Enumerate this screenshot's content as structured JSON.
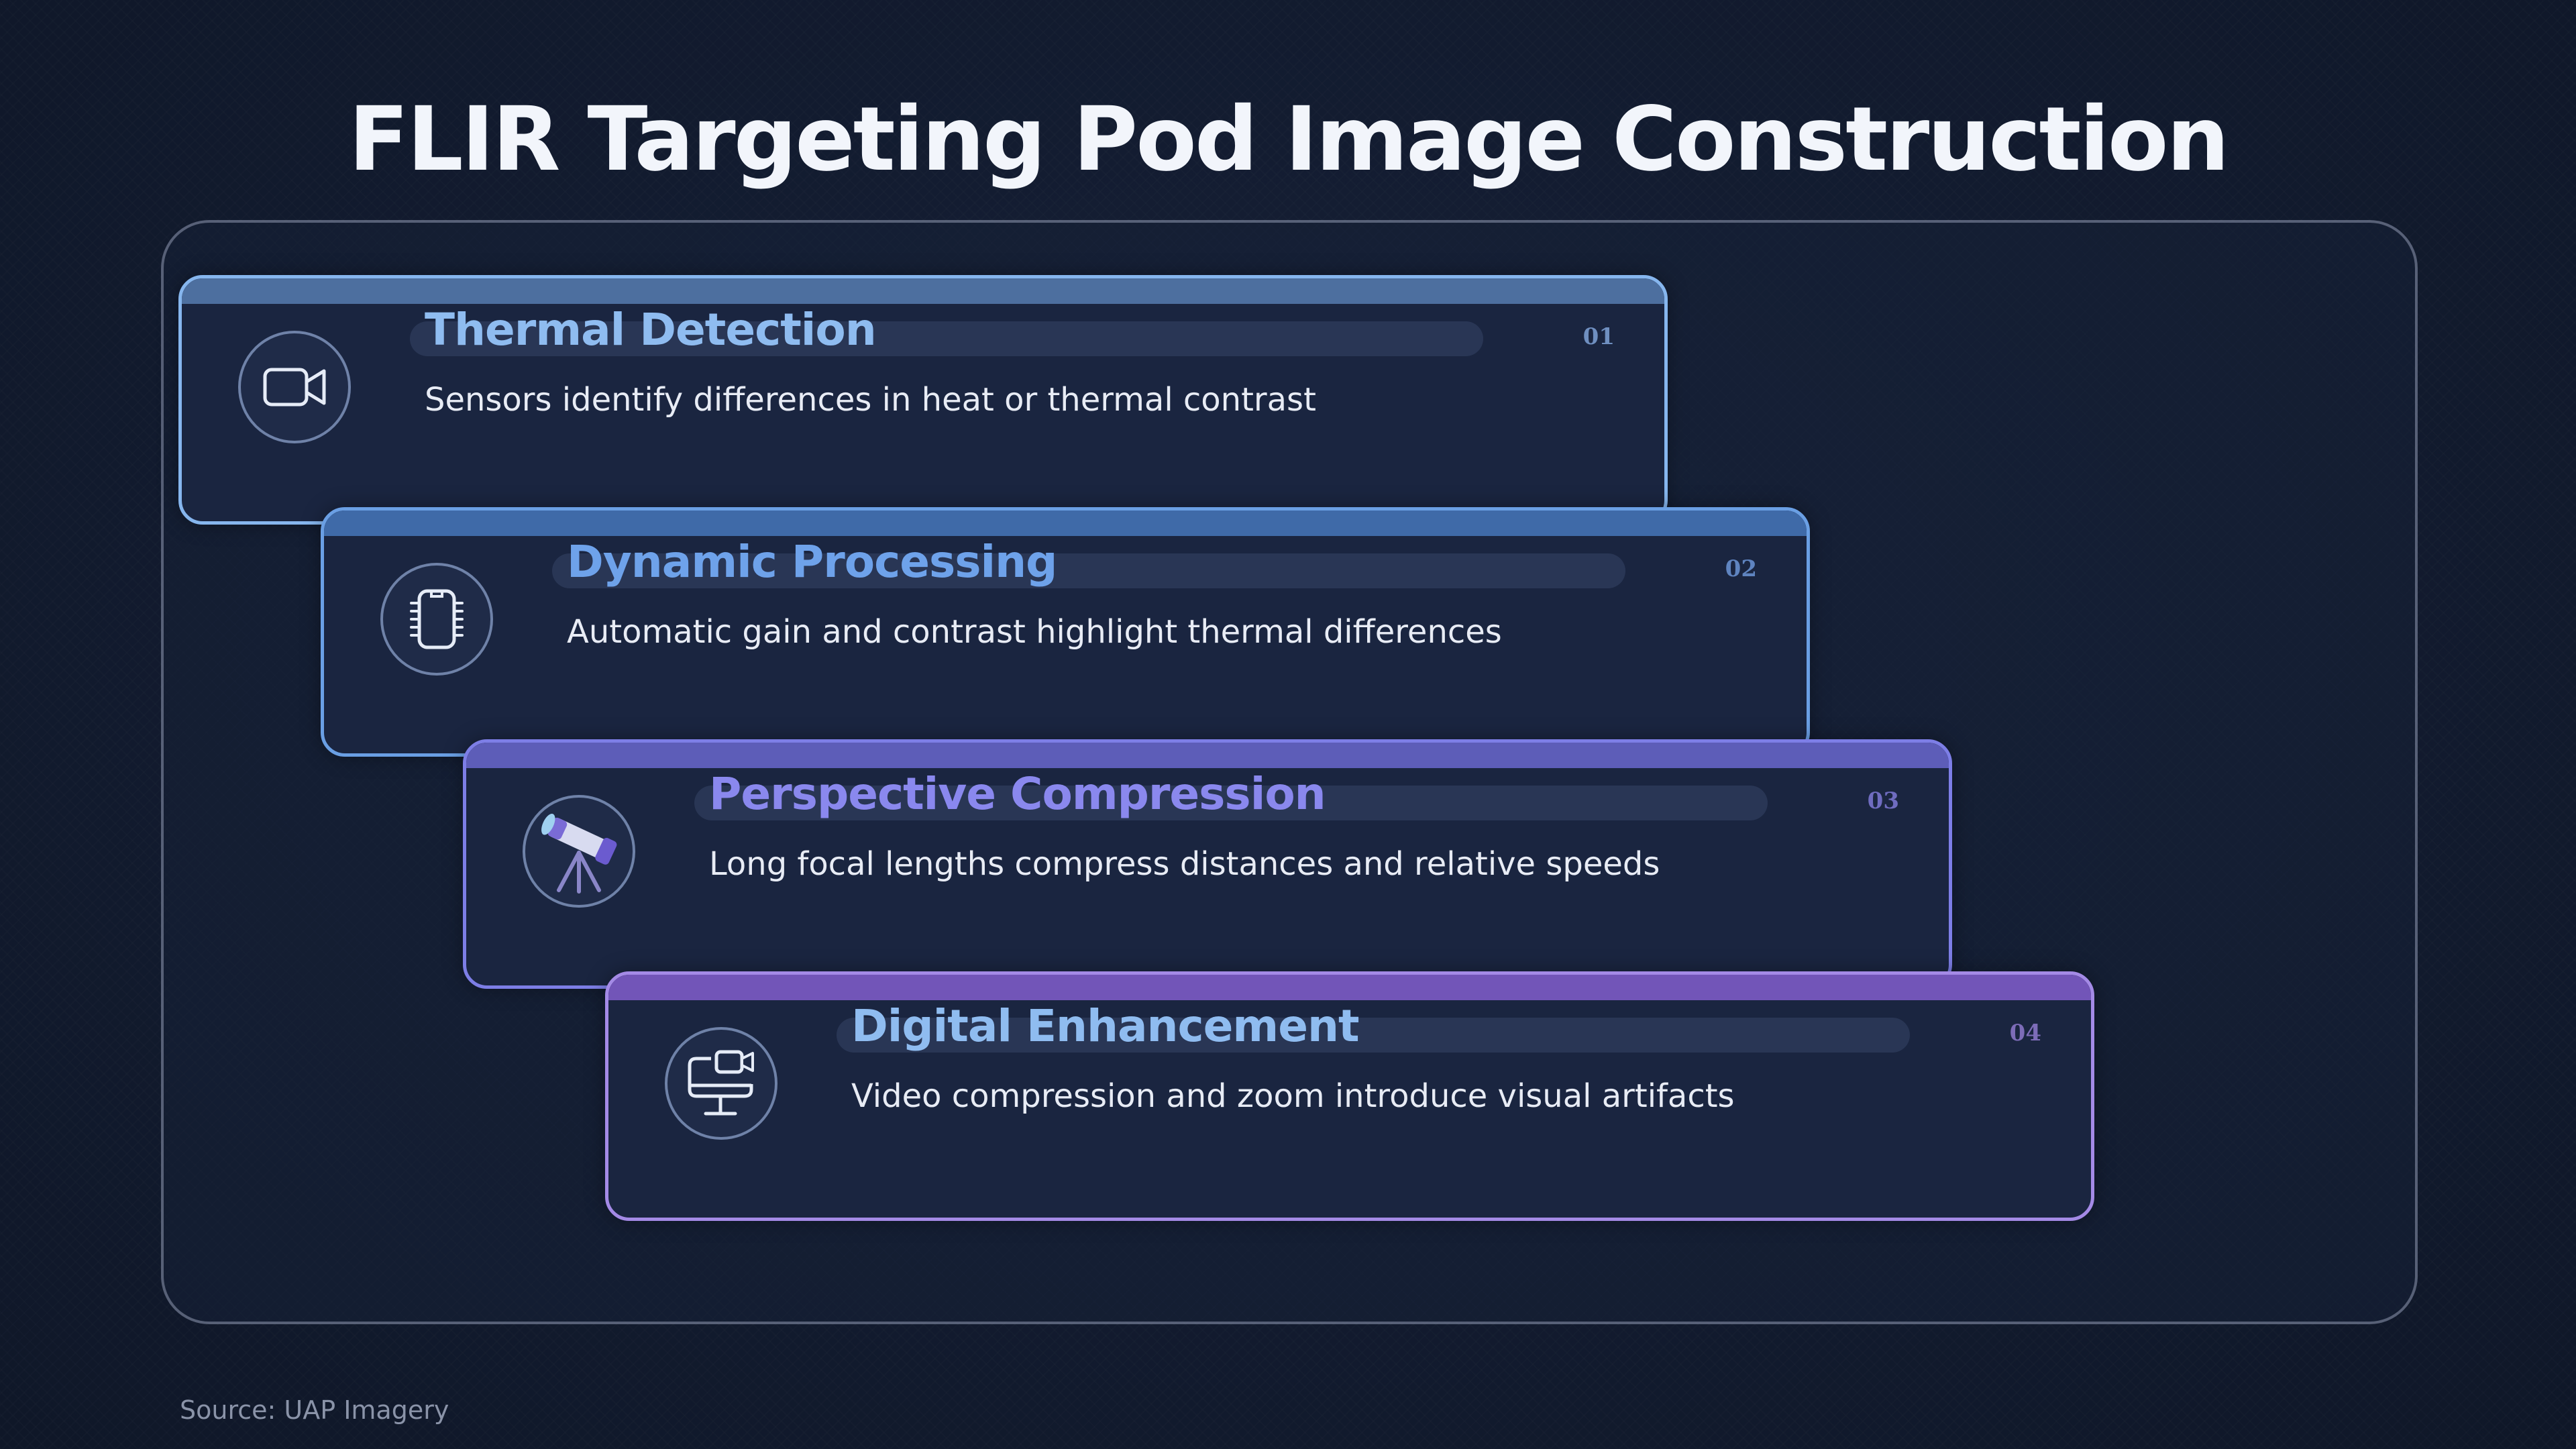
{
  "title": "FLIR Targeting Pod Image Construction",
  "source": "Source: UAP Imagery",
  "steps": [
    {
      "number": "01",
      "heading": "Thermal Detection",
      "description": "Sensors identify differences in heat or thermal contrast",
      "icon": "video-camera-icon",
      "color": "#8fbcf0"
    },
    {
      "number": "02",
      "heading": "Dynamic Processing",
      "description": "Automatic gain and contrast highlight thermal differences",
      "icon": "chip-icon",
      "color": "#6ea2ea"
    },
    {
      "number": "03",
      "heading": "Perspective Compression",
      "description": "Long focal lengths compress distances and relative speeds",
      "icon": "telescope-icon",
      "color": "#8a88ee"
    },
    {
      "number": "04",
      "heading": "Digital Enhancement",
      "description": "Video compression and zoom introduce visual artifacts",
      "icon": "monitor-camera-icon",
      "color": "#a98ae6"
    }
  ]
}
